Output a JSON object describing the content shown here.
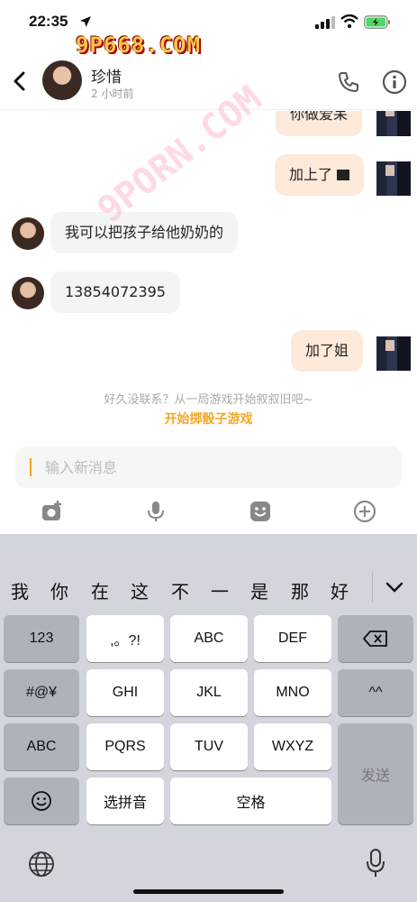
{
  "status_bar": {
    "time": "22:35"
  },
  "watermark": {
    "top_text": "9P668.COM",
    "diagonal_text": "9PORN.COM"
  },
  "header": {
    "contact_name": "珍惜",
    "last_seen": "2 小时前"
  },
  "messages": [
    {
      "direction": "out",
      "text": "你做爱呆"
    },
    {
      "direction": "out",
      "text": "加上了"
    },
    {
      "direction": "in",
      "text": "我可以把孩子给他奶奶的"
    },
    {
      "direction": "in",
      "text": "13854072395"
    },
    {
      "direction": "out",
      "text": "加了姐"
    }
  ],
  "game_hint": {
    "prompt": "好久没联系？从一局游戏开始叙叙旧吧~",
    "link": "开始掷骰子游戏"
  },
  "composer": {
    "placeholder": "输入新消息"
  },
  "toolbar": {
    "icons": [
      "camera-plus-icon",
      "microphone-icon",
      "emoji-icon",
      "plus-circle-icon"
    ]
  },
  "keyboard": {
    "candidates": [
      "我",
      "你",
      "在",
      "这",
      "不",
      "一",
      "是",
      "那",
      "好"
    ],
    "rows": {
      "r1": [
        "123",
        ",。?!",
        "ABC",
        "DEF"
      ],
      "r2": [
        "#@¥",
        "GHI",
        "JKL",
        "MNO",
        "^^"
      ],
      "r3": [
        "ABC",
        "PQRS",
        "TUV",
        "WXYZ"
      ],
      "r4": [
        "选拼音",
        "空格"
      ]
    },
    "send_label": "发送"
  },
  "colors": {
    "accent": "#f5a623",
    "outgoing_bubble": "#fdeadb",
    "incoming_bubble": "#f4f4f4",
    "keyboard_bg": "#d2d5db"
  }
}
